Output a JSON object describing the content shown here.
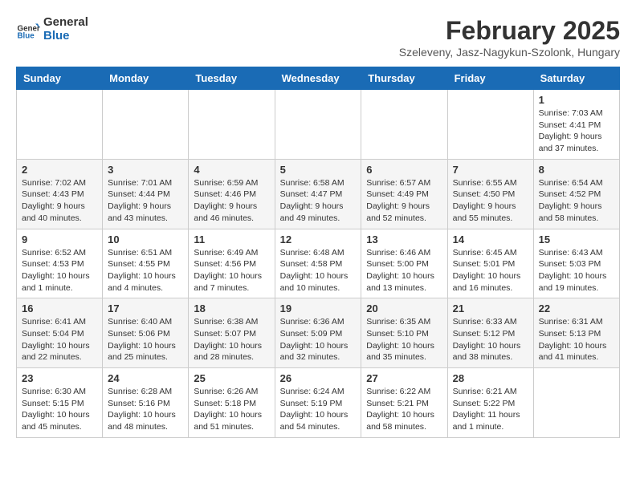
{
  "header": {
    "logo_line1": "General",
    "logo_line2": "Blue",
    "month_year": "February 2025",
    "location": "Szeleveny, Jasz-Nagykun-Szolonk, Hungary"
  },
  "days_of_week": [
    "Sunday",
    "Monday",
    "Tuesday",
    "Wednesday",
    "Thursday",
    "Friday",
    "Saturday"
  ],
  "weeks": [
    [
      {
        "day": "",
        "info": ""
      },
      {
        "day": "",
        "info": ""
      },
      {
        "day": "",
        "info": ""
      },
      {
        "day": "",
        "info": ""
      },
      {
        "day": "",
        "info": ""
      },
      {
        "day": "",
        "info": ""
      },
      {
        "day": "1",
        "info": "Sunrise: 7:03 AM\nSunset: 4:41 PM\nDaylight: 9 hours and 37 minutes."
      }
    ],
    [
      {
        "day": "2",
        "info": "Sunrise: 7:02 AM\nSunset: 4:43 PM\nDaylight: 9 hours and 40 minutes."
      },
      {
        "day": "3",
        "info": "Sunrise: 7:01 AM\nSunset: 4:44 PM\nDaylight: 9 hours and 43 minutes."
      },
      {
        "day": "4",
        "info": "Sunrise: 6:59 AM\nSunset: 4:46 PM\nDaylight: 9 hours and 46 minutes."
      },
      {
        "day": "5",
        "info": "Sunrise: 6:58 AM\nSunset: 4:47 PM\nDaylight: 9 hours and 49 minutes."
      },
      {
        "day": "6",
        "info": "Sunrise: 6:57 AM\nSunset: 4:49 PM\nDaylight: 9 hours and 52 minutes."
      },
      {
        "day": "7",
        "info": "Sunrise: 6:55 AM\nSunset: 4:50 PM\nDaylight: 9 hours and 55 minutes."
      },
      {
        "day": "8",
        "info": "Sunrise: 6:54 AM\nSunset: 4:52 PM\nDaylight: 9 hours and 58 minutes."
      }
    ],
    [
      {
        "day": "9",
        "info": "Sunrise: 6:52 AM\nSunset: 4:53 PM\nDaylight: 10 hours and 1 minute."
      },
      {
        "day": "10",
        "info": "Sunrise: 6:51 AM\nSunset: 4:55 PM\nDaylight: 10 hours and 4 minutes."
      },
      {
        "day": "11",
        "info": "Sunrise: 6:49 AM\nSunset: 4:56 PM\nDaylight: 10 hours and 7 minutes."
      },
      {
        "day": "12",
        "info": "Sunrise: 6:48 AM\nSunset: 4:58 PM\nDaylight: 10 hours and 10 minutes."
      },
      {
        "day": "13",
        "info": "Sunrise: 6:46 AM\nSunset: 5:00 PM\nDaylight: 10 hours and 13 minutes."
      },
      {
        "day": "14",
        "info": "Sunrise: 6:45 AM\nSunset: 5:01 PM\nDaylight: 10 hours and 16 minutes."
      },
      {
        "day": "15",
        "info": "Sunrise: 6:43 AM\nSunset: 5:03 PM\nDaylight: 10 hours and 19 minutes."
      }
    ],
    [
      {
        "day": "16",
        "info": "Sunrise: 6:41 AM\nSunset: 5:04 PM\nDaylight: 10 hours and 22 minutes."
      },
      {
        "day": "17",
        "info": "Sunrise: 6:40 AM\nSunset: 5:06 PM\nDaylight: 10 hours and 25 minutes."
      },
      {
        "day": "18",
        "info": "Sunrise: 6:38 AM\nSunset: 5:07 PM\nDaylight: 10 hours and 28 minutes."
      },
      {
        "day": "19",
        "info": "Sunrise: 6:36 AM\nSunset: 5:09 PM\nDaylight: 10 hours and 32 minutes."
      },
      {
        "day": "20",
        "info": "Sunrise: 6:35 AM\nSunset: 5:10 PM\nDaylight: 10 hours and 35 minutes."
      },
      {
        "day": "21",
        "info": "Sunrise: 6:33 AM\nSunset: 5:12 PM\nDaylight: 10 hours and 38 minutes."
      },
      {
        "day": "22",
        "info": "Sunrise: 6:31 AM\nSunset: 5:13 PM\nDaylight: 10 hours and 41 minutes."
      }
    ],
    [
      {
        "day": "23",
        "info": "Sunrise: 6:30 AM\nSunset: 5:15 PM\nDaylight: 10 hours and 45 minutes."
      },
      {
        "day": "24",
        "info": "Sunrise: 6:28 AM\nSunset: 5:16 PM\nDaylight: 10 hours and 48 minutes."
      },
      {
        "day": "25",
        "info": "Sunrise: 6:26 AM\nSunset: 5:18 PM\nDaylight: 10 hours and 51 minutes."
      },
      {
        "day": "26",
        "info": "Sunrise: 6:24 AM\nSunset: 5:19 PM\nDaylight: 10 hours and 54 minutes."
      },
      {
        "day": "27",
        "info": "Sunrise: 6:22 AM\nSunset: 5:21 PM\nDaylight: 10 hours and 58 minutes."
      },
      {
        "day": "28",
        "info": "Sunrise: 6:21 AM\nSunset: 5:22 PM\nDaylight: 11 hours and 1 minute."
      },
      {
        "day": "",
        "info": ""
      }
    ]
  ]
}
